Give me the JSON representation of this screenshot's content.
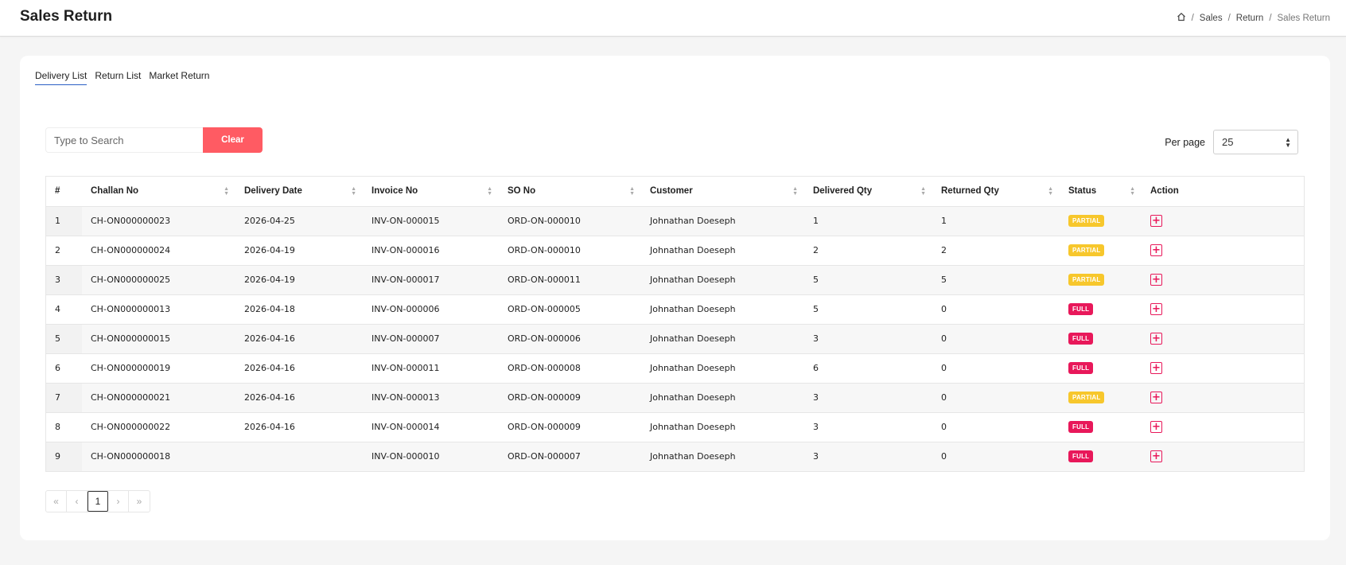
{
  "header": {
    "title": "Sales Return",
    "breadcrumb": [
      "Sales",
      "Return",
      "Sales Return"
    ]
  },
  "tabs": [
    "Delivery List",
    "Return List",
    "Market Return"
  ],
  "search": {
    "placeholder": "Type to Search",
    "value": "",
    "clear_label": "Clear"
  },
  "per_page": {
    "label": "Per page",
    "value": "25"
  },
  "table": {
    "columns": [
      "#",
      "Challan No",
      "Delivery Date",
      "Invoice No",
      "SO No",
      "Customer",
      "Delivered Qty",
      "Returned Qty",
      "Status",
      "Action"
    ],
    "rows": [
      {
        "idx": "1",
        "challan": "CH-ON000000023",
        "date": "2026-04-25",
        "invoice": "INV-ON-000015",
        "so": "ORD-ON-000010",
        "customer": "Johnathan Doeseph",
        "delivered": "1",
        "returned": "1",
        "status": "PARTIAL"
      },
      {
        "idx": "2",
        "challan": "CH-ON000000024",
        "date": "2026-04-19",
        "invoice": "INV-ON-000016",
        "so": "ORD-ON-000010",
        "customer": "Johnathan Doeseph",
        "delivered": "2",
        "returned": "2",
        "status": "PARTIAL"
      },
      {
        "idx": "3",
        "challan": "CH-ON000000025",
        "date": "2026-04-19",
        "invoice": "INV-ON-000017",
        "so": "ORD-ON-000011",
        "customer": "Johnathan Doeseph",
        "delivered": "5",
        "returned": "5",
        "status": "PARTIAL"
      },
      {
        "idx": "4",
        "challan": "CH-ON000000013",
        "date": "2026-04-18",
        "invoice": "INV-ON-000006",
        "so": "ORD-ON-000005",
        "customer": "Johnathan Doeseph",
        "delivered": "5",
        "returned": "0",
        "status": "FULL"
      },
      {
        "idx": "5",
        "challan": "CH-ON000000015",
        "date": "2026-04-16",
        "invoice": "INV-ON-000007",
        "so": "ORD-ON-000006",
        "customer": "Johnathan Doeseph",
        "delivered": "3",
        "returned": "0",
        "status": "FULL"
      },
      {
        "idx": "6",
        "challan": "CH-ON000000019",
        "date": "2026-04-16",
        "invoice": "INV-ON-000011",
        "so": "ORD-ON-000008",
        "customer": "Johnathan Doeseph",
        "delivered": "6",
        "returned": "0",
        "status": "FULL"
      },
      {
        "idx": "7",
        "challan": "CH-ON000000021",
        "date": "2026-04-16",
        "invoice": "INV-ON-000013",
        "so": "ORD-ON-000009",
        "customer": "Johnathan Doeseph",
        "delivered": "3",
        "returned": "0",
        "status": "PARTIAL"
      },
      {
        "idx": "8",
        "challan": "CH-ON000000022",
        "date": "2026-04-16",
        "invoice": "INV-ON-000014",
        "so": "ORD-ON-000009",
        "customer": "Johnathan Doeseph",
        "delivered": "3",
        "returned": "0",
        "status": "FULL"
      },
      {
        "idx": "9",
        "challan": "CH-ON000000018",
        "date": "",
        "invoice": "INV-ON-000010",
        "so": "ORD-ON-000007",
        "customer": "Johnathan Doeseph",
        "delivered": "3",
        "returned": "0",
        "status": "FULL"
      }
    ]
  },
  "pagination": {
    "first": "«",
    "prev": "‹",
    "current": "1",
    "next": "›",
    "last": "»"
  },
  "colors": {
    "accent_red": "#ff5b63",
    "full_badge": "#e8185a",
    "partial_badge": "#f7c72c",
    "tab_underline": "#2a5fc5"
  }
}
